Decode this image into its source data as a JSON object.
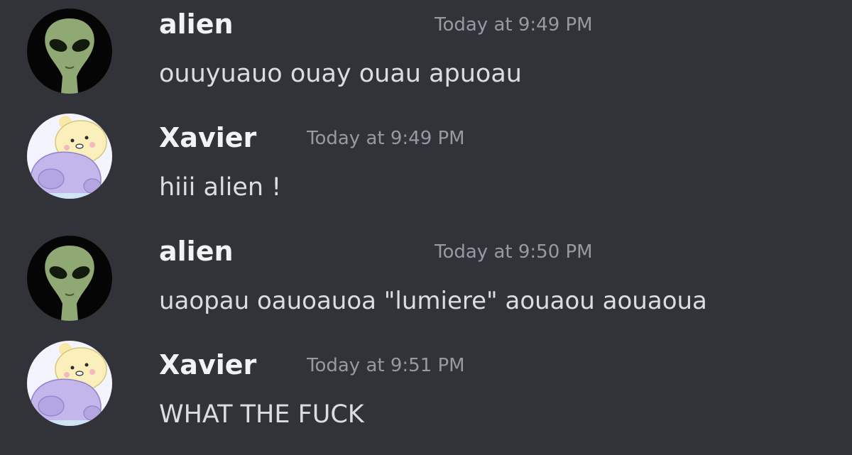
{
  "messages": [
    {
      "author": "alien",
      "avatar": "alien-avatar",
      "timestamp": "Today at 9:49 PM",
      "content": "ouuyuauo ouay ouau apuoau"
    },
    {
      "author": "Xavier",
      "avatar": "bear-avatar",
      "timestamp": "Today at 9:49 PM",
      "content": "hiii alien !"
    },
    {
      "author": "alien",
      "avatar": "alien-avatar",
      "timestamp": "Today at 9:50 PM",
      "content": "uaopau oauoauoa \"lumiere\" aouaou aouaoua"
    },
    {
      "author": "Xavier",
      "avatar": "bear-avatar",
      "timestamp": "Today at 9:51 PM",
      "content": "WHAT THE FUCK"
    }
  ],
  "colors": {
    "background": "#313338",
    "username": "#f2f3f5",
    "timestamp": "#949ba4",
    "content": "#dbdee1"
  }
}
